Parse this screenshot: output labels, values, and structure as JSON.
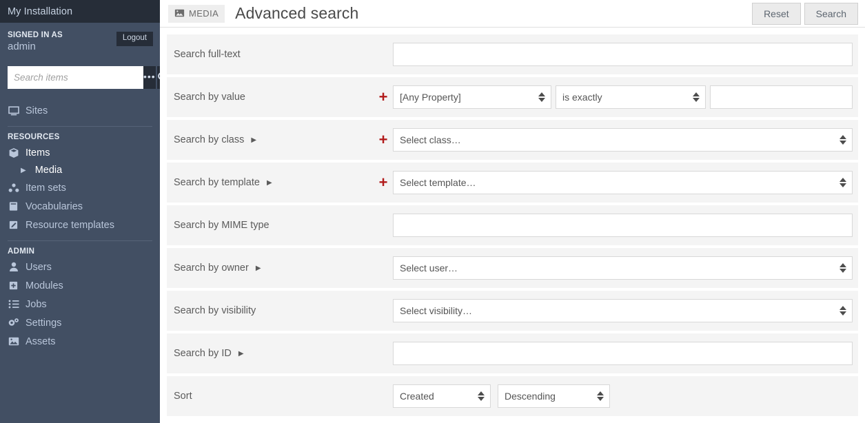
{
  "sidebar": {
    "install_title": "My Installation",
    "signed_in_label": "SIGNED IN AS",
    "username": "admin",
    "logout_label": "Logout",
    "search_placeholder": "Search items",
    "search_value": "",
    "advanced_icon": "ellipsis-icon",
    "search_icon": "search-icon",
    "top_items": [
      {
        "label": "Sites",
        "icon": "monitor-icon",
        "active": false
      }
    ],
    "sections": [
      {
        "label": "RESOURCES",
        "items": [
          {
            "label": "Items",
            "icon": "cube-icon",
            "active": true
          },
          {
            "label": "Media",
            "icon": "caret-right-icon",
            "active": true,
            "sub": true
          },
          {
            "label": "Item sets",
            "icon": "item-sets-icon",
            "active": false
          },
          {
            "label": "Vocabularies",
            "icon": "book-icon",
            "active": false
          },
          {
            "label": "Resource templates",
            "icon": "pencil-square-icon",
            "active": false
          }
        ]
      },
      {
        "label": "ADMIN",
        "items": [
          {
            "label": "Users",
            "icon": "user-icon",
            "active": false
          },
          {
            "label": "Modules",
            "icon": "plus-square-icon",
            "active": false
          },
          {
            "label": "Jobs",
            "icon": "list-icon",
            "active": false
          },
          {
            "label": "Settings",
            "icon": "gears-icon",
            "active": false
          },
          {
            "label": "Assets",
            "icon": "image-icon",
            "active": false
          }
        ]
      }
    ]
  },
  "header": {
    "resource_badge": "MEDIA",
    "resource_badge_icon": "image-icon",
    "title": "Advanced search",
    "reset_label": "Reset",
    "search_label": "Search"
  },
  "form": {
    "fulltext": {
      "label": "Search full-text",
      "value": "",
      "placeholder": ""
    },
    "value_search": {
      "label": "Search by value",
      "add_label": "+",
      "property": "[Any Property]",
      "operator": "is exactly",
      "value": "",
      "placeholder": ""
    },
    "class_search": {
      "label": "Search by class",
      "add_label": "+",
      "select": "Select class…"
    },
    "template_search": {
      "label": "Search by template",
      "add_label": "+",
      "select": "Select template…"
    },
    "mime_search": {
      "label": "Search by MIME type",
      "value": "",
      "placeholder": ""
    },
    "owner_search": {
      "label": "Search by owner",
      "select": "Select user…"
    },
    "visibility_search": {
      "label": "Search by visibility",
      "select": "Select visibility…"
    },
    "id_search": {
      "label": "Search by ID",
      "value": "",
      "placeholder": ""
    },
    "sort": {
      "label": "Sort",
      "by": "Created",
      "direction": "Descending"
    }
  },
  "colors": {
    "sidebar_bg": "#424f63",
    "sidebar_top_bg": "#262d38",
    "row_bg": "#f4f4f4",
    "accent_red": "#b11a1a",
    "text_muted": "#5b5b5b"
  }
}
